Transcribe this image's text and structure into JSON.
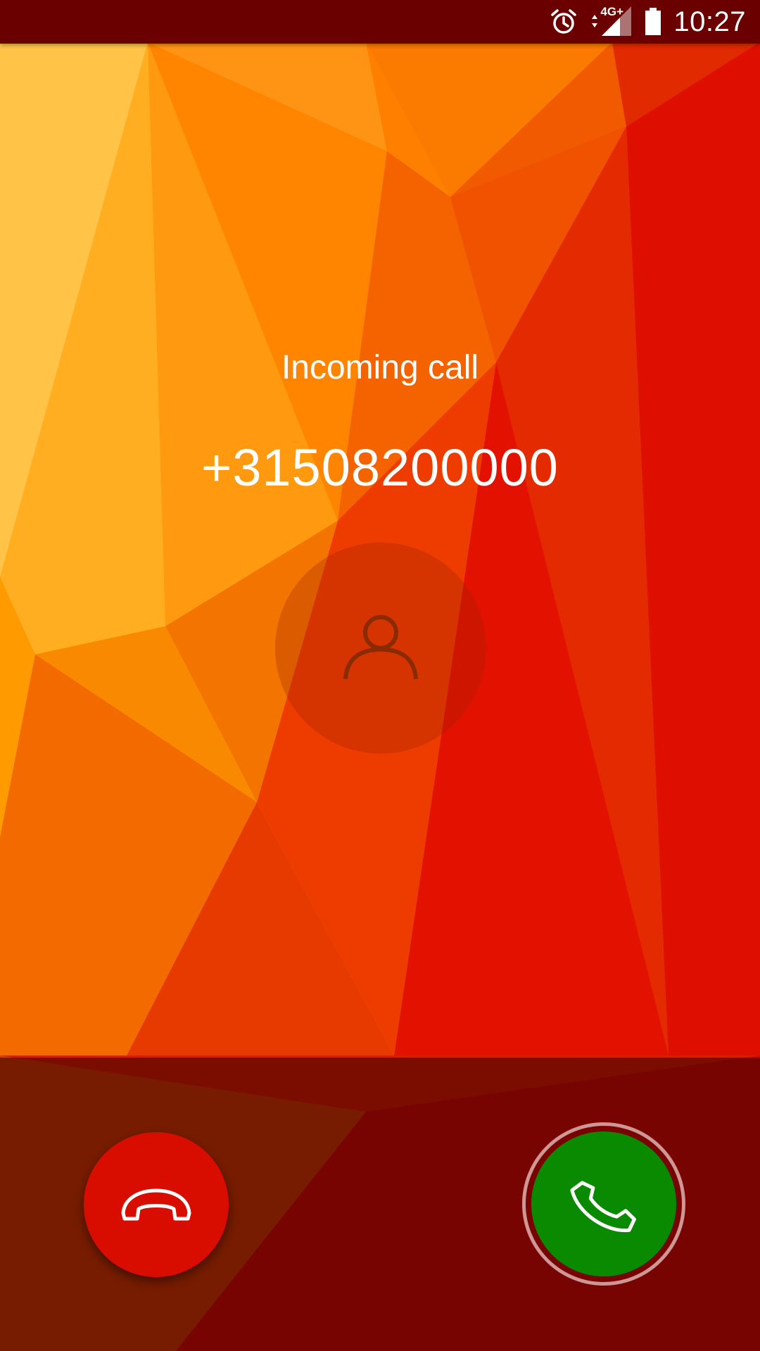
{
  "status_bar": {
    "time": "10:27",
    "network": "4G+",
    "icons": [
      "alarm-icon",
      "data-arrows-icon",
      "signal-icon",
      "battery-icon"
    ]
  },
  "call": {
    "label": "Incoming call",
    "number": "+31508200000"
  },
  "avatar": {
    "icon": "person-icon"
  },
  "actions": {
    "decline_icon": "phone-hangup-icon",
    "answer_icon": "phone-answer-icon"
  },
  "colors": {
    "status_bar": "#6b0000",
    "decline": "#d90c00",
    "answer": "#0a8a00"
  }
}
